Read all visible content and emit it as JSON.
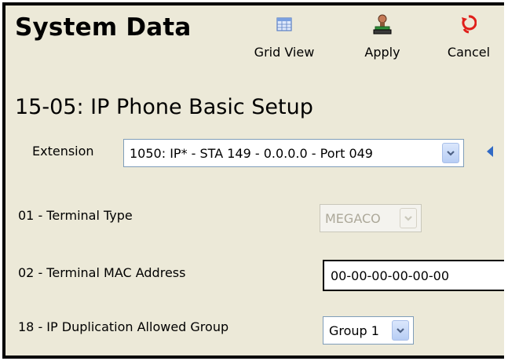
{
  "window": {
    "title": "System Data"
  },
  "toolbar": {
    "grid_view_label": "Grid View",
    "apply_label": "Apply",
    "cancel_label": "Cancel",
    "icons": [
      "grid-view-icon",
      "apply-stamp-icon",
      "cancel-icon"
    ]
  },
  "page": {
    "heading": "15-05: IP Phone Basic Setup"
  },
  "extension": {
    "label": "Extension",
    "selected": "1050: IP* - STA 149 - 0.0.0.0 - Port 049"
  },
  "fields": {
    "terminal_type": {
      "label": "01 - Terminal Type",
      "value": "MEGACO",
      "disabled": true
    },
    "mac_address": {
      "label": "02 - Terminal MAC Address",
      "value": "00-00-00-00-00-00"
    },
    "dup_group": {
      "label": "18 - IP Duplication Allowed Group",
      "value": "Group 1"
    }
  },
  "colors": {
    "background": "#ece9d8",
    "dropdown_arrow": "#4d6185",
    "nav_arrow": "#316ac5",
    "cancel_icon": "#e0201b"
  }
}
